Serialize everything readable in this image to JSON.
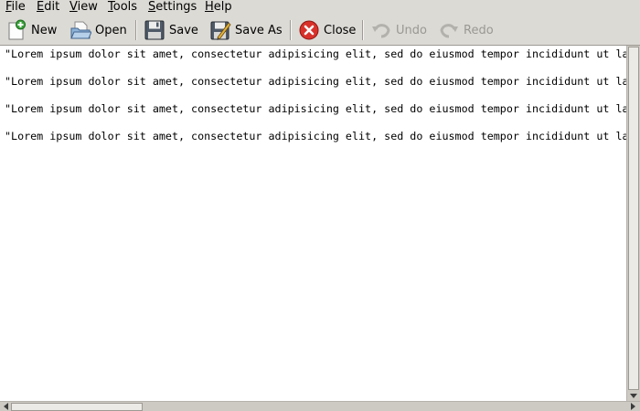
{
  "menubar": {
    "items": [
      {
        "accel": "F",
        "rest": "ile"
      },
      {
        "accel": "E",
        "rest": "dit"
      },
      {
        "accel": "V",
        "rest": "iew"
      },
      {
        "accel": "T",
        "rest": "ools"
      },
      {
        "accel": "S",
        "rest": "ettings"
      },
      {
        "accel": "H",
        "rest": "elp"
      }
    ]
  },
  "toolbar": {
    "new_label": "New",
    "open_label": "Open",
    "save_label": "Save",
    "save_as_label": "Save As",
    "close_label": "Close",
    "undo_label": "Undo",
    "redo_label": "Redo",
    "icons": {
      "new": "new-document-icon",
      "open": "open-folder-icon",
      "save": "floppy-disk-icon",
      "save_as": "save-as-icon",
      "close": "close-icon",
      "undo": "undo-icon",
      "redo": "redo-icon"
    },
    "disabled": [
      "undo",
      "redo"
    ]
  },
  "editor": {
    "lines": [
      "\"Lorem ipsum dolor sit amet, consectetur adipisicing elit, sed do eiusmod tempor incididunt ut la",
      "",
      "\"Lorem ipsum dolor sit amet, consectetur adipisicing elit, sed do eiusmod tempor incididunt ut la",
      "",
      "\"Lorem ipsum dolor sit amet, consectetur adipisicing elit, sed do eiusmod tempor incididunt ut la",
      "",
      "\"Lorem ipsum dolor sit amet, consectetur adipisicing elit, sed do eiusmod tempor incididunt ut la"
    ]
  },
  "colors": {
    "window_bg": "#dcdad5",
    "editor_bg": "#ffffff",
    "close_red": "#d8312a",
    "disabled_text": "#9a9893"
  }
}
